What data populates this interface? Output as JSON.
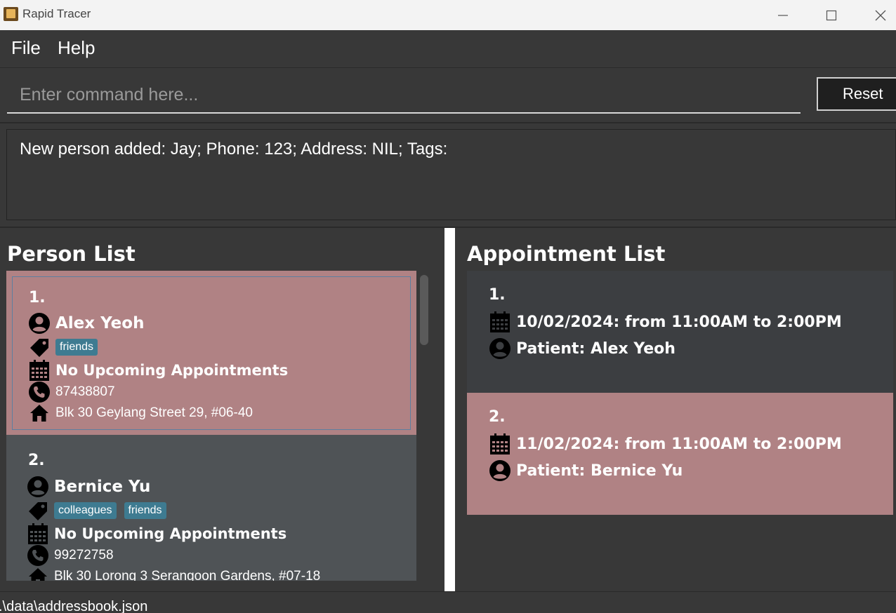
{
  "window": {
    "title": "Rapid Tracer"
  },
  "menu": {
    "file": "File",
    "help": "Help"
  },
  "command": {
    "placeholder": "Enter command here...",
    "reset_label": "Reset"
  },
  "result": {
    "text": "New person added: Jay; Phone: 123; Address: NIL; Tags:"
  },
  "person_list": {
    "title": "Person List",
    "items": [
      {
        "index": "1.",
        "name": "Alex Yeoh",
        "tags": [
          "friends"
        ],
        "appointment": "No Upcoming Appointments",
        "phone": "87438807",
        "address": "Blk 30 Geylang Street 29, #06-40"
      },
      {
        "index": "2.",
        "name": "Bernice Yu",
        "tags": [
          "colleagues",
          "friends"
        ],
        "appointment": "No Upcoming Appointments",
        "phone": "99272758",
        "address": "Blk 30 Lorong 3 Serangoon Gardens, #07-18"
      }
    ]
  },
  "appointment_list": {
    "title": "Appointment List",
    "items": [
      {
        "index": "1.",
        "datetime": "10/02/2024: from 11:00AM to 2:00PM",
        "patient": "Patient: Alex Yeoh"
      },
      {
        "index": "2.",
        "datetime": "11/02/2024: from 11:00AM to 2:00PM",
        "patient": "Patient: Bernice Yu"
      }
    ]
  },
  "status": {
    "path": ".\\data\\addressbook.json"
  },
  "colors": {
    "selected_card": "#b08284",
    "normal_card": "#4f5356",
    "tag": "#3e7b91"
  }
}
